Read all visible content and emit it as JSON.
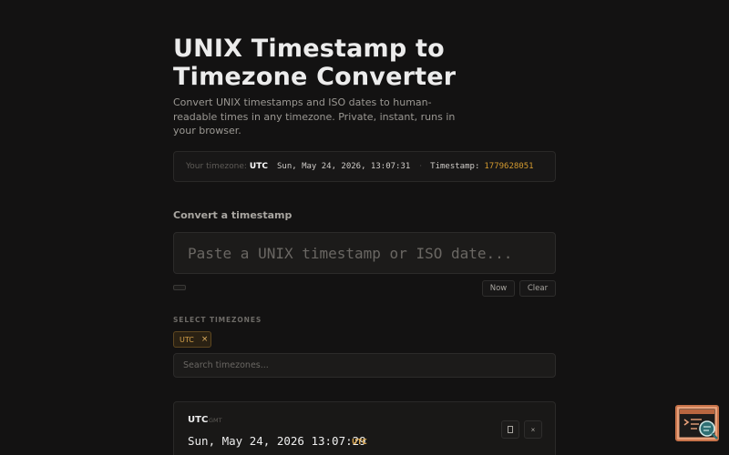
{
  "header": {
    "title_line1": "UNIX Timestamp to",
    "title_line2": "Timezone Converter",
    "subtitle": "Convert UNIX timestamps and ISO dates to human-readable times in any timezone. Private, instant, runs in your browser."
  },
  "status_bar": {
    "timezone_label": "Your timezone:",
    "timezone_value": "UTC",
    "current_time": "Sun, May 24, 2026, 13:07:31",
    "separator": "·",
    "timestamp_label": "Timestamp:",
    "timestamp_value": "1779628051"
  },
  "converter": {
    "section_title": "Convert a timestamp",
    "input_placeholder": "Paste a UNIX timestamp or ISO date...",
    "input_value": "",
    "now_label": "Now",
    "clear_label": "Clear"
  },
  "timezones": {
    "heading": "SELECT TIMEZONES",
    "selected": [
      {
        "label": "UTC",
        "remove_symbol": "×"
      }
    ],
    "search_placeholder": "Search timezones..."
  },
  "results": [
    {
      "timezone": "UTC",
      "offset": "GMT",
      "time": "Sun, May 24, 2026 13:07:29",
      "abbr": "UTC",
      "copy_icon": "copy-icon",
      "remove_symbol": "×"
    }
  ],
  "colors": {
    "background": "#131212",
    "accent": "#d39a2f",
    "chip_bg": "#2a2113",
    "fab_bg": "#e8a07a"
  },
  "floating_widget": {
    "icon": "terminal-search-icon"
  }
}
